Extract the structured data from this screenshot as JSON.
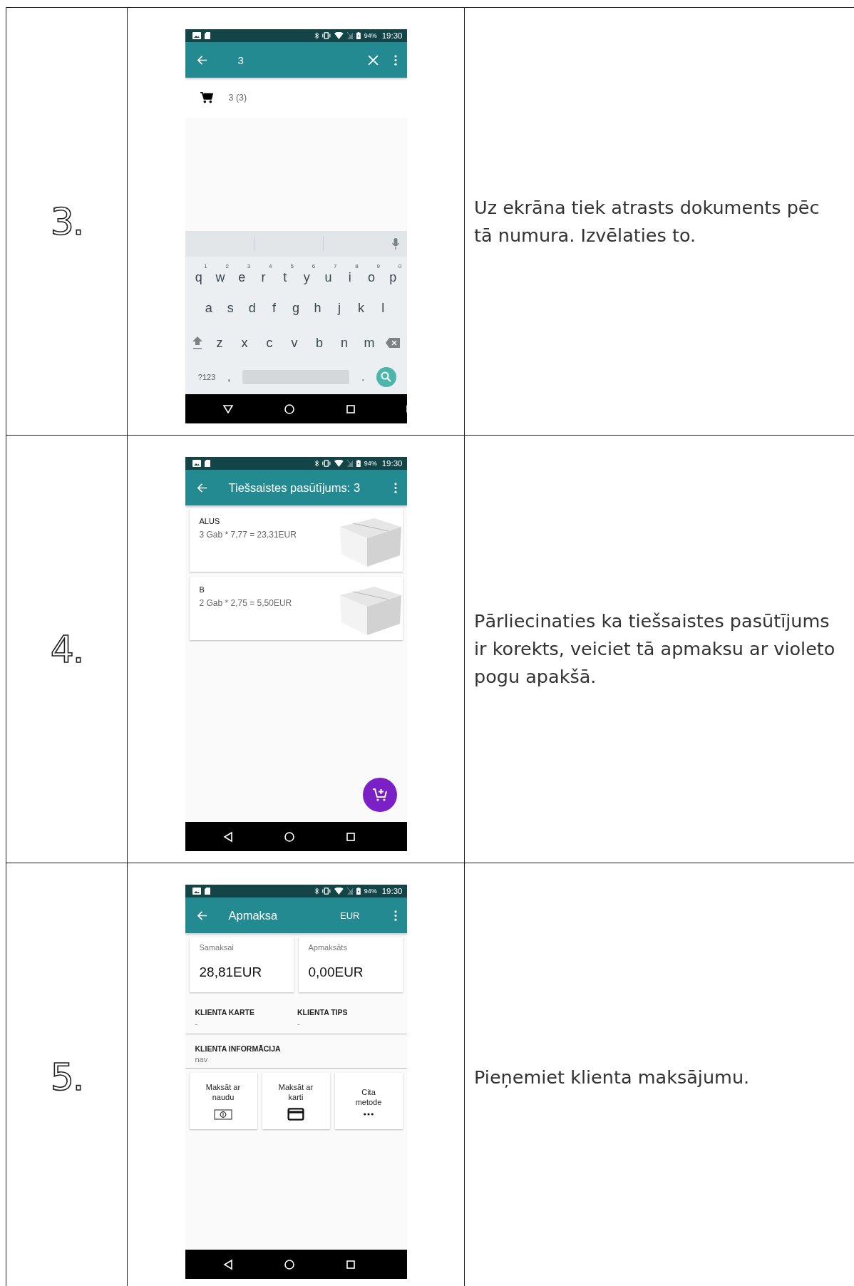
{
  "rows": [
    {
      "number": "3.",
      "description": [
        "Uz ekrāna tiek atrasts dokuments pēc",
        "tā numura. Izvēlaties to."
      ],
      "screen": {
        "kind": "search",
        "status": {
          "battery": "94%",
          "time": "19:30"
        },
        "query": "3",
        "results": [
          {
            "label": "3 (3)"
          }
        ],
        "keyboard": {
          "rows": [
            [
              {
                "key": "q",
                "hint": "1"
              },
              {
                "key": "w",
                "hint": "2"
              },
              {
                "key": "e",
                "hint": "3"
              },
              {
                "key": "r",
                "hint": "4"
              },
              {
                "key": "t",
                "hint": "5"
              },
              {
                "key": "y",
                "hint": "6"
              },
              {
                "key": "u",
                "hint": "7"
              },
              {
                "key": "i",
                "hint": "8"
              },
              {
                "key": "o",
                "hint": "9"
              },
              {
                "key": "p",
                "hint": "0"
              }
            ],
            [
              {
                "key": "a"
              },
              {
                "key": "s"
              },
              {
                "key": "d"
              },
              {
                "key": "f"
              },
              {
                "key": "g"
              },
              {
                "key": "h"
              },
              {
                "key": "j"
              },
              {
                "key": "k"
              },
              {
                "key": "l"
              }
            ],
            [
              {
                "key": "z"
              },
              {
                "key": "x"
              },
              {
                "key": "c"
              },
              {
                "key": "v"
              },
              {
                "key": "b"
              },
              {
                "key": "n"
              },
              {
                "key": "m"
              }
            ]
          ],
          "symbols_key": "?123",
          "comma": ",",
          "period": "."
        }
      }
    },
    {
      "number": "4.",
      "description": [
        "Pārliecinaties ka tiešsaistes pasūtījums",
        "ir korekts, veiciet tā apmaksu ar violeto",
        "pogu apakšā."
      ],
      "screen": {
        "kind": "order",
        "status": {
          "battery": "94%",
          "time": "19:30"
        },
        "title": "Tiešsaistes pasūtījums: 3",
        "items": [
          {
            "name": "ALUS",
            "line": "3 Gab * 7,77 = 23,31EUR"
          },
          {
            "name": "B",
            "line": "2 Gab * 2,75 = 5,50EUR"
          }
        ]
      }
    },
    {
      "number": "5.",
      "description": [
        "Pieņemiet klienta maksājumu."
      ],
      "screen": {
        "kind": "payment",
        "status": {
          "battery": "94%",
          "time": "19:30"
        },
        "title": "Apmaksa",
        "currency": "EUR",
        "totals": [
          {
            "label": "Samaksai",
            "value": "28,81EUR"
          },
          {
            "label": "Apmaksāts",
            "value": "0,00EUR"
          }
        ],
        "fields": [
          {
            "label": "KLIENTA KARTE",
            "value": "-"
          },
          {
            "label": "KLIENTA TIPS",
            "value": "-"
          }
        ],
        "info": {
          "label": "KLIENTA INFORMĀCIJA",
          "value": "nav"
        },
        "methods": [
          {
            "kind": "cash",
            "lines": [
              "Maksāt ar",
              "naudu"
            ]
          },
          {
            "kind": "card",
            "lines": [
              "Maksāt ar",
              "karti"
            ]
          },
          {
            "kind": "other",
            "lines": [
              "Cita",
              "metode"
            ]
          }
        ]
      }
    }
  ]
}
